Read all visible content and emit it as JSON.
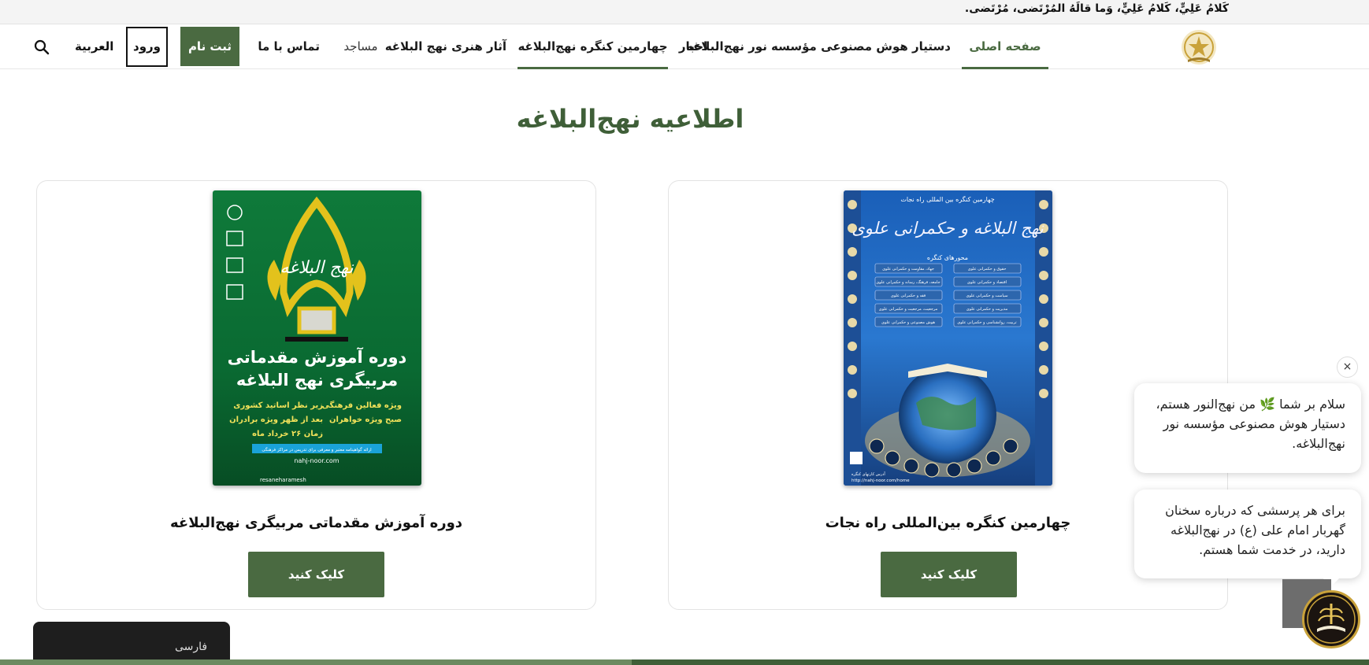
{
  "quote_bar": {
    "text": "كَلامُ عَلِيٍّ، كَلامُ عَلِيٍّ، وَما قالَهُ المُرْتَضى، مُرْتَضى."
  },
  "nav": {
    "items": [
      {
        "label": "صفحه اصلی",
        "active": true
      },
      {
        "label": "دستیار هوش مصنوعی مؤسسه نور نهج‌البلاغه"
      },
      {
        "label": "اخبار"
      },
      {
        "label": "چهارمین کنگره نهج‌البلاغه",
        "active": true
      },
      {
        "label": "آثار هنری نهج البلاغه"
      },
      {
        "label": "مساجد"
      },
      {
        "label": "تماس با ما"
      }
    ],
    "register_label": "ثبت نام",
    "login_label": "ورود",
    "language_label": "العربية",
    "search_icon": "search-icon",
    "logo_icon": "nahj-logo-icon"
  },
  "main": {
    "title": "اطلاعیه نهج‌البلاغه",
    "cards": [
      {
        "title": "چهارمین کنگره بین‌المللی راه نجات",
        "button_label": "کلیک کنید",
        "poster": {
          "headline": "چهارمین کنگره بین المللی راه نجات",
          "calligraphy": "نهج البلاغه و حکمرانی علوی",
          "section_label": "محورهای کنگره",
          "topics": [
            "حقوق و حکمرانی علوی",
            "جهاد، مقاومت و حکمرانی علوی",
            "اقتصاد و حکمرانی علوی",
            "جامعه، فرهنگ، رسانه و حکمرانی علوی",
            "سیاست و حکمرانی علوی",
            "فقه و حکمرانی علوی",
            "مدیریت و حکمرانی علوی",
            "مرجعیت، مرجعیت و حکمرانی علوی",
            "تربیت، روانشناسی و حکمرانی علوی",
            "هوش مصنوعی و حکمرانی علوی"
          ],
          "footer": "آدرس کارتهای کنگره",
          "url": "http://nahj-noor.com/home"
        }
      },
      {
        "title": "دوره آموزش مقدماتی مربیگری نهج‌البلاغه",
        "button_label": "کلیک کنید",
        "poster": {
          "calligraphy": "نهج البلاغه",
          "headline": "دوره آموزش مقدماتی مربیگری نهج البلاغه",
          "points": [
            "ویژه فعالین فرهنگی",
            "زیر نظر اساتید کشوری",
            "صبح ویژه خواهران",
            "بعد از ظهر ویژه برادران",
            "زمان ۲۶ خرداد ماه"
          ],
          "banner": "ارائه گواهینامه معتبر و معرفی برای تدریس در مراکز فرهنگی",
          "site": "nahj-noor.com",
          "handle": "resaneharamesh"
        }
      }
    ]
  },
  "chat": {
    "greeting": "سلام بر شما 🌿 من نهج‌النور هستم، دستیار هوش مصنوعی مؤسسه نور نهج‌البلاغه.",
    "message": "برای هر پرسشی که درباره سخنان گهربار امام علی (ع) در نهج‌البلاغه دارید، در خدمت شما هستم.",
    "close_label": "×"
  },
  "language_switcher": {
    "label": "فارسی"
  },
  "colors": {
    "brand_green": "#4a6a41",
    "title_green": "#3f5f38"
  }
}
